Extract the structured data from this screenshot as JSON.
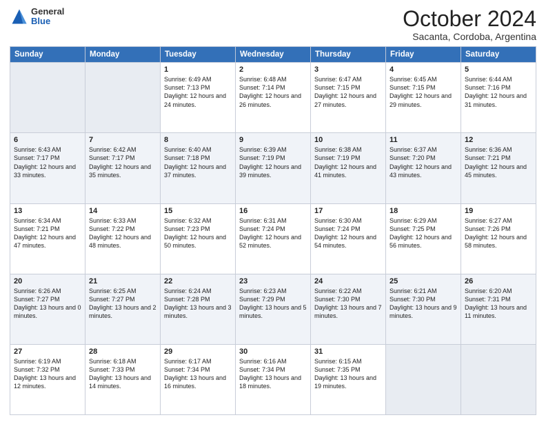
{
  "header": {
    "logo": {
      "general": "General",
      "blue": "Blue"
    },
    "title": "October 2024",
    "subtitle": "Sacanta, Cordoba, Argentina"
  },
  "days_of_week": [
    "Sunday",
    "Monday",
    "Tuesday",
    "Wednesday",
    "Thursday",
    "Friday",
    "Saturday"
  ],
  "weeks": [
    [
      {
        "day": "",
        "info": ""
      },
      {
        "day": "",
        "info": ""
      },
      {
        "day": "1",
        "info": "Sunrise: 6:49 AM\nSunset: 7:13 PM\nDaylight: 12 hours and 24 minutes."
      },
      {
        "day": "2",
        "info": "Sunrise: 6:48 AM\nSunset: 7:14 PM\nDaylight: 12 hours and 26 minutes."
      },
      {
        "day": "3",
        "info": "Sunrise: 6:47 AM\nSunset: 7:15 PM\nDaylight: 12 hours and 27 minutes."
      },
      {
        "day": "4",
        "info": "Sunrise: 6:45 AM\nSunset: 7:15 PM\nDaylight: 12 hours and 29 minutes."
      },
      {
        "day": "5",
        "info": "Sunrise: 6:44 AM\nSunset: 7:16 PM\nDaylight: 12 hours and 31 minutes."
      }
    ],
    [
      {
        "day": "6",
        "info": "Sunrise: 6:43 AM\nSunset: 7:17 PM\nDaylight: 12 hours and 33 minutes."
      },
      {
        "day": "7",
        "info": "Sunrise: 6:42 AM\nSunset: 7:17 PM\nDaylight: 12 hours and 35 minutes."
      },
      {
        "day": "8",
        "info": "Sunrise: 6:40 AM\nSunset: 7:18 PM\nDaylight: 12 hours and 37 minutes."
      },
      {
        "day": "9",
        "info": "Sunrise: 6:39 AM\nSunset: 7:19 PM\nDaylight: 12 hours and 39 minutes."
      },
      {
        "day": "10",
        "info": "Sunrise: 6:38 AM\nSunset: 7:19 PM\nDaylight: 12 hours and 41 minutes."
      },
      {
        "day": "11",
        "info": "Sunrise: 6:37 AM\nSunset: 7:20 PM\nDaylight: 12 hours and 43 minutes."
      },
      {
        "day": "12",
        "info": "Sunrise: 6:36 AM\nSunset: 7:21 PM\nDaylight: 12 hours and 45 minutes."
      }
    ],
    [
      {
        "day": "13",
        "info": "Sunrise: 6:34 AM\nSunset: 7:21 PM\nDaylight: 12 hours and 47 minutes."
      },
      {
        "day": "14",
        "info": "Sunrise: 6:33 AM\nSunset: 7:22 PM\nDaylight: 12 hours and 48 minutes."
      },
      {
        "day": "15",
        "info": "Sunrise: 6:32 AM\nSunset: 7:23 PM\nDaylight: 12 hours and 50 minutes."
      },
      {
        "day": "16",
        "info": "Sunrise: 6:31 AM\nSunset: 7:24 PM\nDaylight: 12 hours and 52 minutes."
      },
      {
        "day": "17",
        "info": "Sunrise: 6:30 AM\nSunset: 7:24 PM\nDaylight: 12 hours and 54 minutes."
      },
      {
        "day": "18",
        "info": "Sunrise: 6:29 AM\nSunset: 7:25 PM\nDaylight: 12 hours and 56 minutes."
      },
      {
        "day": "19",
        "info": "Sunrise: 6:27 AM\nSunset: 7:26 PM\nDaylight: 12 hours and 58 minutes."
      }
    ],
    [
      {
        "day": "20",
        "info": "Sunrise: 6:26 AM\nSunset: 7:27 PM\nDaylight: 13 hours and 0 minutes."
      },
      {
        "day": "21",
        "info": "Sunrise: 6:25 AM\nSunset: 7:27 PM\nDaylight: 13 hours and 2 minutes."
      },
      {
        "day": "22",
        "info": "Sunrise: 6:24 AM\nSunset: 7:28 PM\nDaylight: 13 hours and 3 minutes."
      },
      {
        "day": "23",
        "info": "Sunrise: 6:23 AM\nSunset: 7:29 PM\nDaylight: 13 hours and 5 minutes."
      },
      {
        "day": "24",
        "info": "Sunrise: 6:22 AM\nSunset: 7:30 PM\nDaylight: 13 hours and 7 minutes."
      },
      {
        "day": "25",
        "info": "Sunrise: 6:21 AM\nSunset: 7:30 PM\nDaylight: 13 hours and 9 minutes."
      },
      {
        "day": "26",
        "info": "Sunrise: 6:20 AM\nSunset: 7:31 PM\nDaylight: 13 hours and 11 minutes."
      }
    ],
    [
      {
        "day": "27",
        "info": "Sunrise: 6:19 AM\nSunset: 7:32 PM\nDaylight: 13 hours and 12 minutes."
      },
      {
        "day": "28",
        "info": "Sunrise: 6:18 AM\nSunset: 7:33 PM\nDaylight: 13 hours and 14 minutes."
      },
      {
        "day": "29",
        "info": "Sunrise: 6:17 AM\nSunset: 7:34 PM\nDaylight: 13 hours and 16 minutes."
      },
      {
        "day": "30",
        "info": "Sunrise: 6:16 AM\nSunset: 7:34 PM\nDaylight: 13 hours and 18 minutes."
      },
      {
        "day": "31",
        "info": "Sunrise: 6:15 AM\nSunset: 7:35 PM\nDaylight: 13 hours and 19 minutes."
      },
      {
        "day": "",
        "info": ""
      },
      {
        "day": "",
        "info": ""
      }
    ]
  ]
}
